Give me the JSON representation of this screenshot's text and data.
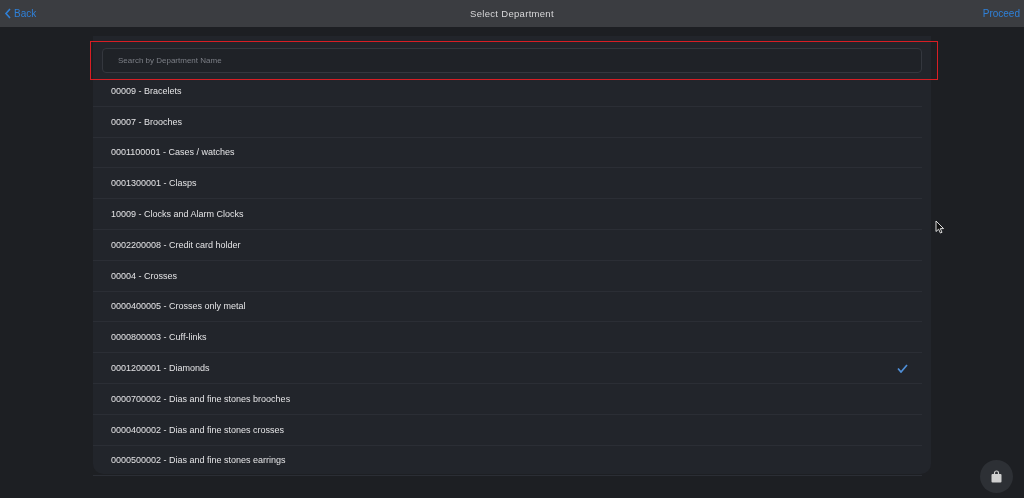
{
  "nav_bar": {
    "back": "Back",
    "title": "Select Department",
    "proceed": "Proceed"
  },
  "search": {
    "placeholder": "Search by Department Name",
    "highlighted": true
  },
  "departments": [
    {
      "label": "00009 - Bracelets",
      "selected": false
    },
    {
      "label": "00007 - Brooches",
      "selected": false
    },
    {
      "label": "0001100001 - Cases / watches",
      "selected": false
    },
    {
      "label": "0001300001 - Clasps",
      "selected": false
    },
    {
      "label": "10009 - Clocks and Alarm Clocks",
      "selected": false
    },
    {
      "label": "0002200008 - Credit card holder",
      "selected": false
    },
    {
      "label": "00004 - Crosses",
      "selected": false
    },
    {
      "label": "0000400005 - Crosses only metal",
      "selected": false
    },
    {
      "label": "0000800003 - Cuff-links",
      "selected": false
    },
    {
      "label": "0001200001 - Diamonds",
      "selected": true
    },
    {
      "label": "0000700002 - Dias and fine stones brooches",
      "selected": false
    },
    {
      "label": "0000400002 - Dias and fine stones crosses",
      "selected": false
    },
    {
      "label": "0000500002 - Dias and fine stones earrings",
      "selected": false
    }
  ]
}
